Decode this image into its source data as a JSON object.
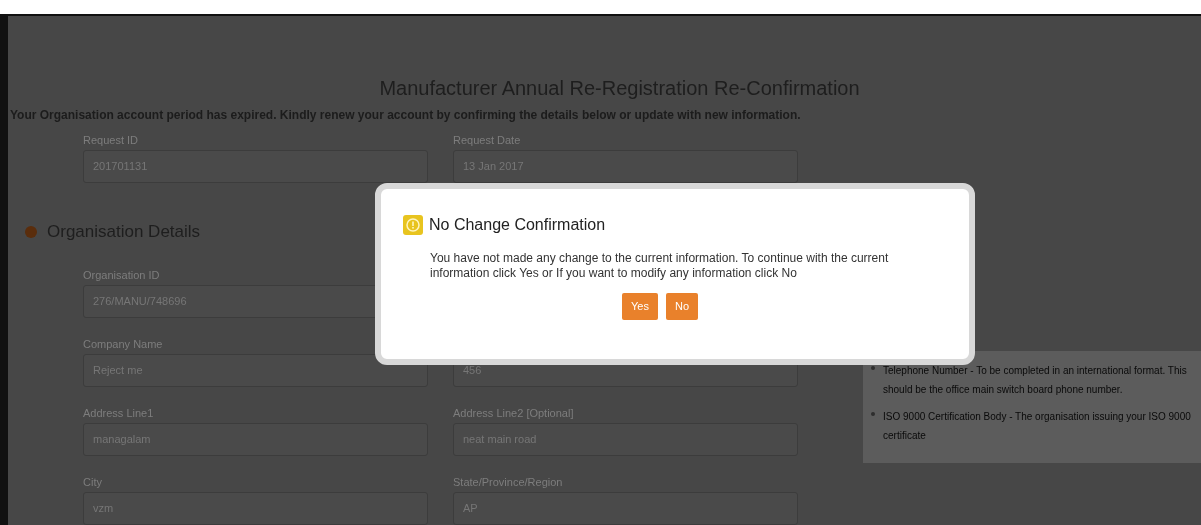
{
  "page": {
    "title": "Manufacturer Annual Re-Registration Re-Confirmation",
    "notice": "Your Organisation account period has expired. Kindly renew your account by confirming the details below or update with new information."
  },
  "request_row": {
    "left": {
      "label": "Request ID",
      "value": "201701131"
    },
    "right": {
      "label": "Request Date",
      "value": "13 Jan 2017"
    }
  },
  "section": {
    "title": "Organisation Details"
  },
  "field_rows": [
    {
      "left": {
        "label": "Organisation ID",
        "value": "276/MANU/748696"
      }
    },
    {
      "left": {
        "label": "Company Name",
        "value": "Reject me"
      },
      "right": {
        "value": "456"
      }
    },
    {
      "left": {
        "label": "Address Line1",
        "value": "managalam"
      },
      "right": {
        "label": "Address Line2 [Optional]",
        "value": "neat main road"
      }
    },
    {
      "left": {
        "label": "City",
        "value": "vzm"
      },
      "right": {
        "label": "State/Province/Region",
        "value": "AP"
      }
    }
  ],
  "hints": [
    {
      "text": "Telephone Number - To be completed in an international format. This should be the office main switch board phone number."
    },
    {
      "text": "ISO 9000 Certification Body - The organisation issuing your ISO 9000 certificate"
    }
  ],
  "dialog": {
    "title": "No Change Confirmation",
    "message": "You have not made any change to the current information. To continue with the current information click Yes or If you want to modify any information click No",
    "buttons": [
      "Yes",
      "No"
    ]
  }
}
